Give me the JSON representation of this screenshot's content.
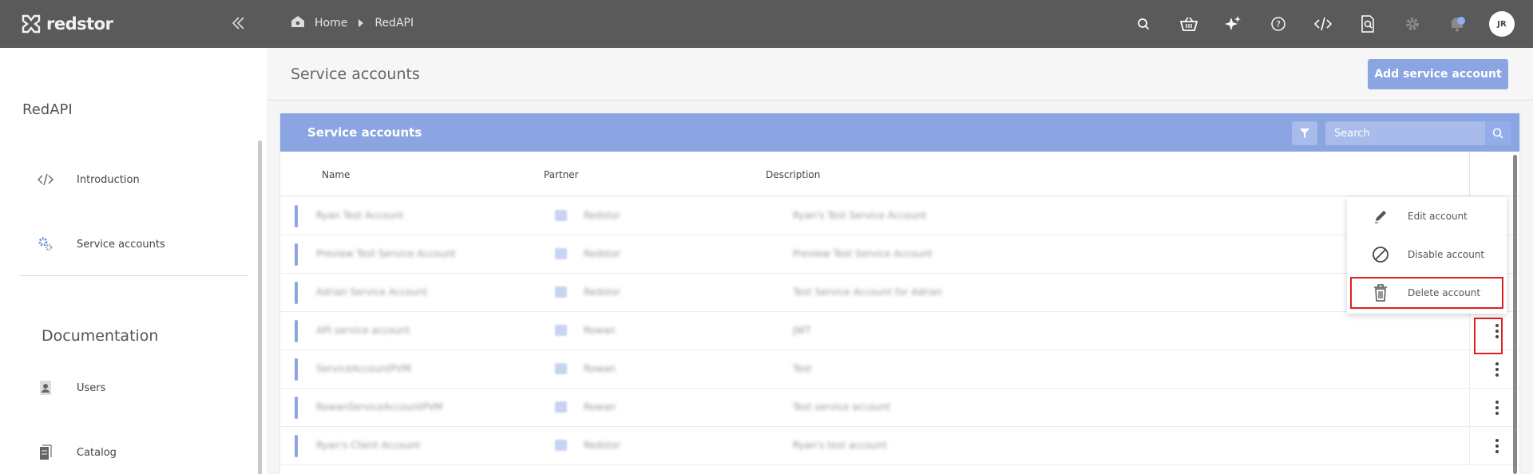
{
  "app": {
    "logo_text": "redstor",
    "avatar_initials": "JR"
  },
  "breadcrumb": {
    "items": [
      "Home",
      "RedAPI"
    ]
  },
  "top_icons": [
    "search-icon",
    "basket-icon",
    "sparkle-icon",
    "help-icon",
    "code-icon",
    "search-doc-icon",
    "gear-icon",
    "notification-icon"
  ],
  "sidebar": {
    "title": "RedAPI",
    "items": [
      {
        "label": "Introduction",
        "icon": "code-icon"
      },
      {
        "label": "Service accounts",
        "icon": "gears-icon"
      }
    ],
    "section_title": "Documentation",
    "doc_items": [
      {
        "label": "Users",
        "icon": "user-icon"
      },
      {
        "label": "Catalog",
        "icon": "catalog-icon"
      }
    ]
  },
  "page": {
    "title": "Service accounts",
    "add_button": "Add service account"
  },
  "panel": {
    "title": "Service accounts",
    "search_placeholder": "Search",
    "columns": [
      "Name",
      "Partner",
      "Description"
    ]
  },
  "rows": [
    {
      "name": "Ryan Test Account",
      "partner": "Redstor",
      "description": "Ryan's Test Service Account"
    },
    {
      "name": "Preview Test Service Account",
      "partner": "Redstor",
      "description": "Preview Test Service Account"
    },
    {
      "name": "Adrian Service Account",
      "partner": "Redstor",
      "description": "Test Service Account for Adrian"
    },
    {
      "name": "API service account",
      "partner": "Rowan",
      "description": "JWT"
    },
    {
      "name": "ServiceAccountPVM",
      "partner": "Rowan",
      "description": "Test"
    },
    {
      "name": "RowanServiceAccountPVM",
      "partner": "Rowan",
      "description": "Test service account"
    },
    {
      "name": "Ryan's Client Account",
      "partner": "Redstor",
      "description": "Ryan's test account"
    }
  ],
  "context_menu": {
    "items": [
      {
        "label": "Edit account",
        "icon": "pencil-icon"
      },
      {
        "label": "Disable account",
        "icon": "disable-icon"
      },
      {
        "label": "Delete account",
        "icon": "trash-icon"
      }
    ]
  },
  "colors": {
    "topbar": "#5a5a5a",
    "accent": "#8aa5e2",
    "highlight": "#e02020"
  }
}
